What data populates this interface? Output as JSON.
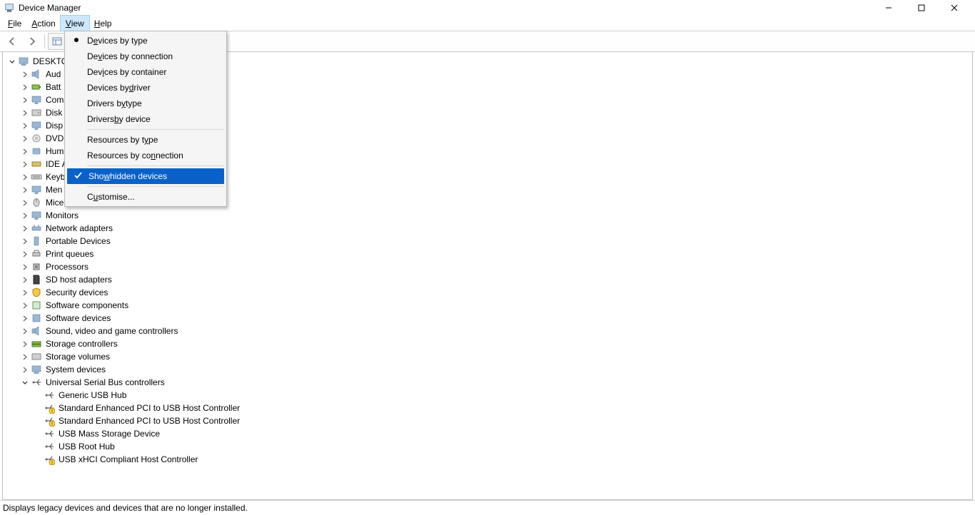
{
  "window": {
    "title": "Device Manager"
  },
  "menubar": [
    {
      "pre": "",
      "u": "F",
      "post": "ile",
      "id": "file"
    },
    {
      "pre": "",
      "u": "A",
      "post": "ction",
      "id": "action"
    },
    {
      "pre": "",
      "u": "V",
      "post": "iew",
      "id": "view",
      "open": true
    },
    {
      "pre": "",
      "u": "H",
      "post": "elp",
      "id": "help"
    }
  ],
  "view_menu": {
    "groups": [
      [
        {
          "pre": "D",
          "u": "e",
          "post": "vices by type",
          "bullet": true
        },
        {
          "pre": "De",
          "u": "v",
          "post": "ices by connection"
        },
        {
          "pre": "Dev",
          "u": "i",
          "post": "ces by container"
        },
        {
          "pre": "Devices by ",
          "u": "d",
          "post": "river"
        },
        {
          "pre": "Drivers b",
          "u": "y",
          "post": " type"
        },
        {
          "pre": "Drivers ",
          "u": "b",
          "post": "y device"
        }
      ],
      [
        {
          "pre": "Resources by t",
          "u": "y",
          "post": "pe"
        },
        {
          "pre": "Resources by co",
          "u": "n",
          "post": "nection"
        }
      ],
      [
        {
          "pre": "Sho",
          "u": "w",
          "post": " hidden devices",
          "check": true,
          "hl": true
        }
      ],
      [
        {
          "pre": "C",
          "u": "u",
          "post": "stomise..."
        }
      ]
    ]
  },
  "tree": {
    "root": {
      "label": "DESKTO",
      "icon": "computer"
    },
    "categories": [
      {
        "label": "Aud",
        "icon": "audio"
      },
      {
        "label": "Batt",
        "icon": "battery"
      },
      {
        "label": "Com",
        "icon": "monitor"
      },
      {
        "label": "Disk",
        "icon": "disk"
      },
      {
        "label": "Disp",
        "icon": "monitor"
      },
      {
        "label": "DVD",
        "icon": "disc"
      },
      {
        "label": "Hum",
        "icon": "hid"
      },
      {
        "label": "IDE A",
        "icon": "ide"
      },
      {
        "label": "Keyb",
        "icon": "keyboard"
      },
      {
        "label": "Men",
        "icon": "monitor"
      },
      {
        "label": "Mice",
        "icon": "mouse"
      },
      {
        "label": "Monitors",
        "icon": "monitor"
      },
      {
        "label": "Network adapters",
        "icon": "network"
      },
      {
        "label": "Portable Devices",
        "icon": "portable"
      },
      {
        "label": "Print queues",
        "icon": "printer"
      },
      {
        "label": "Processors",
        "icon": "cpu"
      },
      {
        "label": "SD host adapters",
        "icon": "sd"
      },
      {
        "label": "Security devices",
        "icon": "security"
      },
      {
        "label": "Software components",
        "icon": "softcomp"
      },
      {
        "label": "Software devices",
        "icon": "softdev"
      },
      {
        "label": "Sound, video and game controllers",
        "icon": "audio"
      },
      {
        "label": "Storage controllers",
        "icon": "storage"
      },
      {
        "label": "Storage volumes",
        "icon": "volume"
      },
      {
        "label": "System devices",
        "icon": "system"
      }
    ],
    "usb": {
      "label": "Universal Serial Bus controllers",
      "children": [
        {
          "label": "Generic USB Hub",
          "warn": false
        },
        {
          "label": "Standard Enhanced PCI to USB Host Controller",
          "warn": true
        },
        {
          "label": "Standard Enhanced PCI to USB Host Controller",
          "warn": true
        },
        {
          "label": "USB Mass Storage Device",
          "warn": false
        },
        {
          "label": "USB Root Hub",
          "warn": false
        },
        {
          "label": "USB xHCI Compliant Host Controller",
          "warn": true
        }
      ]
    }
  },
  "statusbar": {
    "text": "Displays legacy devices and devices that are no longer installed."
  }
}
